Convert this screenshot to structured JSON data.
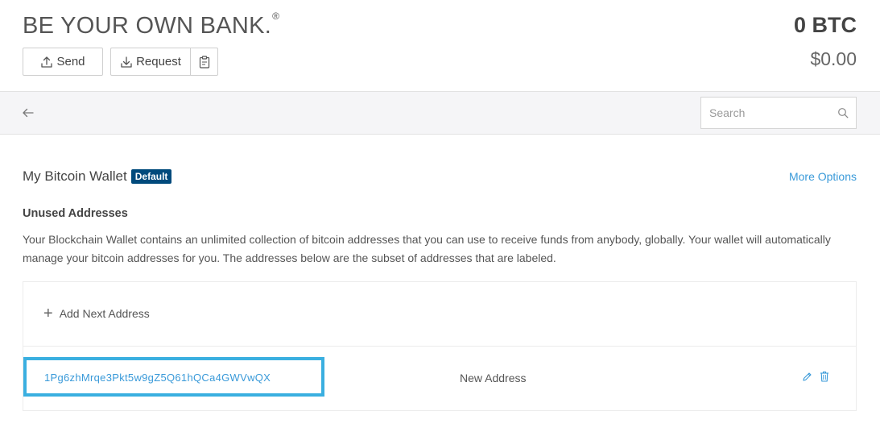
{
  "header": {
    "tagline": "BE YOUR OWN BANK.",
    "tagline_mark": "®",
    "send_label": "Send",
    "request_label": "Request",
    "balance_btc": "0 BTC",
    "balance_usd": "$0.00"
  },
  "nav": {
    "back_icon": "arrow-left-icon",
    "search_placeholder": "Search",
    "search_value": ""
  },
  "wallet": {
    "name": "My Bitcoin Wallet",
    "badge": "Default",
    "more_options_label": "More Options",
    "section_heading": "Unused Addresses",
    "description": "Your Blockchain Wallet contains an unlimited collection of bitcoin addresses that you can use to receive funds from anybody, globally. Your wallet will automatically manage your bitcoin addresses for you. The addresses below are the subset of addresses that are labeled."
  },
  "addresses": {
    "add_label": "Add Next Address",
    "rows": [
      {
        "address": "1Pg6zhMrqe3Pkt5w9gZ5Q61hQCa4GWVwQX",
        "label": "New Address",
        "highlighted": true
      }
    ]
  },
  "colors": {
    "accent_link": "#3a9ad9",
    "badge_bg": "#004a7c",
    "highlight_border": "#3aafe0",
    "nav_bg": "#f5f5f7"
  }
}
